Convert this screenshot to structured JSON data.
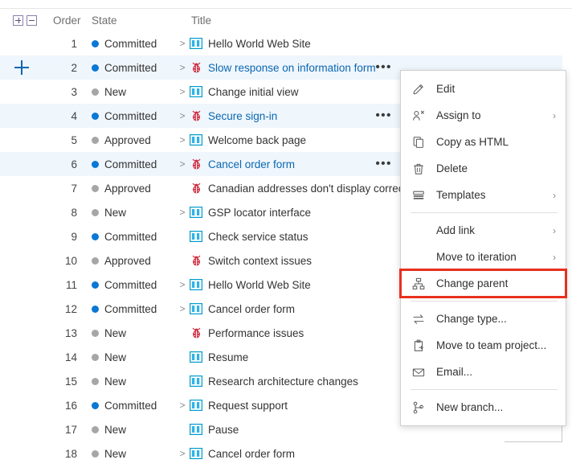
{
  "grid": {
    "header": {
      "expand_all_label": "expand-all",
      "collapse_all_label": "collapse-all",
      "order": "Order",
      "state": "State",
      "title": "Title"
    },
    "rows": [
      {
        "order": "1",
        "state": "Committed",
        "dot": "blue",
        "chevron": ">",
        "icon": "story-icon",
        "title": "Hello World Web Site",
        "link": false,
        "alt": false,
        "ellipsis": false,
        "expander": false
      },
      {
        "order": "2",
        "state": "Committed",
        "dot": "blue",
        "chevron": ">",
        "icon": "bug-icon",
        "title": "Slow response on information form",
        "link": true,
        "alt": true,
        "ellipsis": true,
        "expander": true
      },
      {
        "order": "3",
        "state": "New",
        "dot": "gray",
        "chevron": ">",
        "icon": "story-icon",
        "title": "Change initial view",
        "link": false,
        "alt": false,
        "ellipsis": false,
        "expander": false
      },
      {
        "order": "4",
        "state": "Committed",
        "dot": "blue",
        "chevron": ">",
        "icon": "bug-icon",
        "title": "Secure sign-in",
        "link": true,
        "alt": true,
        "ellipsis": true,
        "expander": false
      },
      {
        "order": "5",
        "state": "Approved",
        "dot": "gray",
        "chevron": ">",
        "icon": "story-icon",
        "title": "Welcome back page",
        "link": false,
        "alt": false,
        "ellipsis": false,
        "expander": false
      },
      {
        "order": "6",
        "state": "Committed",
        "dot": "blue",
        "chevron": ">",
        "icon": "bug-icon",
        "title": "Cancel order form",
        "link": true,
        "alt": true,
        "ellipsis": true,
        "expander": false
      },
      {
        "order": "7",
        "state": "Approved",
        "dot": "gray",
        "chevron": "",
        "icon": "bug-icon",
        "title": "Canadian addresses don't display correctly",
        "link": false,
        "alt": false,
        "ellipsis": false,
        "expander": false
      },
      {
        "order": "8",
        "state": "New",
        "dot": "gray",
        "chevron": ">",
        "icon": "story-icon",
        "title": "GSP locator interface",
        "link": false,
        "alt": false,
        "ellipsis": false,
        "expander": false
      },
      {
        "order": "9",
        "state": "Committed",
        "dot": "blue",
        "chevron": "",
        "icon": "story-icon",
        "title": "Check service status",
        "link": false,
        "alt": false,
        "ellipsis": false,
        "expander": false
      },
      {
        "order": "10",
        "state": "Approved",
        "dot": "gray",
        "chevron": "",
        "icon": "bug-icon",
        "title": "Switch context issues",
        "link": false,
        "alt": false,
        "ellipsis": false,
        "expander": false
      },
      {
        "order": "11",
        "state": "Committed",
        "dot": "blue",
        "chevron": ">",
        "icon": "story-icon",
        "title": "Hello World Web Site",
        "link": false,
        "alt": false,
        "ellipsis": false,
        "expander": false
      },
      {
        "order": "12",
        "state": "Committed",
        "dot": "blue",
        "chevron": ">",
        "icon": "story-icon",
        "title": "Cancel order form",
        "link": false,
        "alt": false,
        "ellipsis": false,
        "expander": false
      },
      {
        "order": "13",
        "state": "New",
        "dot": "gray",
        "chevron": "",
        "icon": "bug-icon",
        "title": "Performance issues",
        "link": false,
        "alt": false,
        "ellipsis": false,
        "expander": false
      },
      {
        "order": "14",
        "state": "New",
        "dot": "gray",
        "chevron": "",
        "icon": "story-icon",
        "title": "Resume",
        "link": false,
        "alt": false,
        "ellipsis": false,
        "expander": false
      },
      {
        "order": "15",
        "state": "New",
        "dot": "gray",
        "chevron": "",
        "icon": "story-icon",
        "title": "Research architecture changes",
        "link": false,
        "alt": false,
        "ellipsis": false,
        "expander": false
      },
      {
        "order": "16",
        "state": "Committed",
        "dot": "blue",
        "chevron": ">",
        "icon": "story-icon",
        "title": "Request support",
        "link": false,
        "alt": false,
        "ellipsis": false,
        "expander": false
      },
      {
        "order": "17",
        "state": "New",
        "dot": "gray",
        "chevron": "",
        "icon": "story-icon",
        "title": "Pause",
        "link": false,
        "alt": false,
        "ellipsis": false,
        "expander": false
      },
      {
        "order": "18",
        "state": "New",
        "dot": "gray",
        "chevron": ">",
        "icon": "story-icon",
        "title": "Cancel order form",
        "link": false,
        "alt": false,
        "ellipsis": false,
        "expander": false
      }
    ],
    "ellipsis_glyph": "•••"
  },
  "context_menu": {
    "items": [
      {
        "kind": "item",
        "icon": "pencil-icon",
        "label": "Edit",
        "submenu": "",
        "highlight": false
      },
      {
        "kind": "item",
        "icon": "assign-person-icon",
        "label": "Assign to",
        "submenu": "›",
        "highlight": false
      },
      {
        "kind": "item",
        "icon": "copy-icon",
        "label": "Copy as HTML",
        "submenu": "",
        "highlight": false
      },
      {
        "kind": "item",
        "icon": "trash-icon",
        "label": "Delete",
        "submenu": "",
        "highlight": false
      },
      {
        "kind": "item",
        "icon": "templates-icon",
        "label": "Templates",
        "submenu": "›",
        "highlight": false
      },
      {
        "kind": "separator"
      },
      {
        "kind": "item",
        "icon": "",
        "label": "Add link",
        "submenu": "›",
        "highlight": false
      },
      {
        "kind": "item",
        "icon": "",
        "label": "Move to iteration",
        "submenu": "›",
        "highlight": false
      },
      {
        "kind": "item",
        "icon": "hierarchy-icon",
        "label": "Change parent",
        "submenu": "",
        "highlight": true
      },
      {
        "kind": "separator"
      },
      {
        "kind": "item",
        "icon": "swap-icon",
        "label": "Change type...",
        "submenu": "",
        "highlight": false
      },
      {
        "kind": "item",
        "icon": "clipboard-move-icon",
        "label": "Move to team project...",
        "submenu": "",
        "highlight": false
      },
      {
        "kind": "item",
        "icon": "envelope-icon",
        "label": "Email...",
        "submenu": "",
        "highlight": false
      },
      {
        "kind": "separator"
      },
      {
        "kind": "item",
        "icon": "branch-icon",
        "label": "New branch...",
        "submenu": "",
        "highlight": false
      }
    ]
  },
  "colors": {
    "accent_blue": "#0a67b1",
    "state_committed": "#0a78d4",
    "state_default": "#a6a6a6",
    "row_alt_bg": "#eff6fc",
    "highlight_red": "#e8301f",
    "bug_red": "#cc293d",
    "story_blue": "#009ccc"
  }
}
